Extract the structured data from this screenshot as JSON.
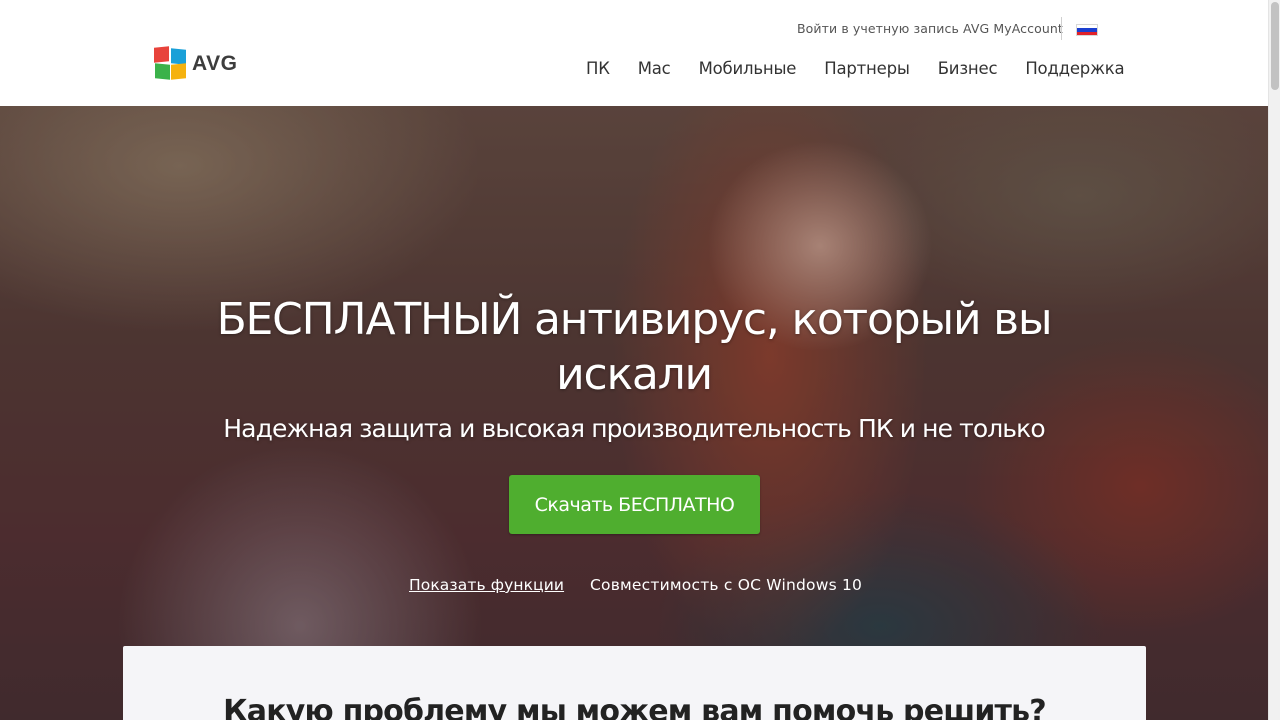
{
  "header": {
    "logo_text": "AVG",
    "account_link": "Войти в учетную запись AVG MyAccount",
    "language_flag": "russia-flag-icon",
    "nav": [
      {
        "label": "ПК"
      },
      {
        "label": "Mac"
      },
      {
        "label": "Мобильные"
      },
      {
        "label": "Партнеры"
      },
      {
        "label": "Бизнес"
      },
      {
        "label": "Поддержка"
      }
    ]
  },
  "hero": {
    "title": "БЕСПЛАТНЫЙ антивирус, который вы искали",
    "subtitle": "Надежная защита и высокая производительность ПК и не только",
    "download_button": "Скачать БЕСПЛАТНО",
    "features_link": "Показать функции",
    "compatibility": "Совместимость с ОС Windows 10"
  },
  "help_card": {
    "title": "Какую проблему мы можем вам помочь решить?"
  },
  "colors": {
    "accent_green": "#4fae2f",
    "text_dark": "#333333"
  }
}
